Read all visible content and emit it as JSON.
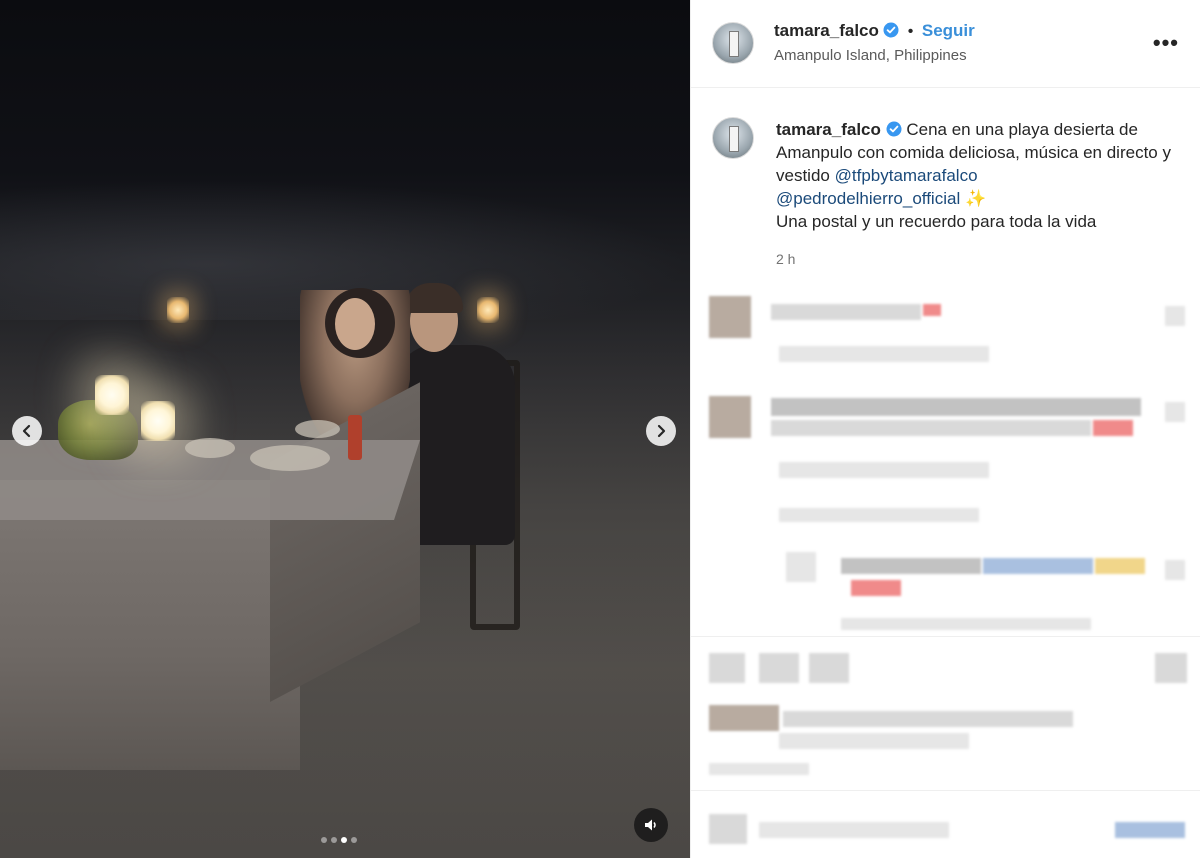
{
  "post": {
    "username": "tamara_falco",
    "follow_label": "Seguir",
    "separator": "•",
    "location": "Amanpulo Island, Philippines",
    "more_label": "•••"
  },
  "caption": {
    "username": "tamara_falco",
    "text_1": "Cena en una playa desierta de Amanpulo con comida deliciosa, música en directo y vestido",
    "mention_1": "@tfpbytamarafalco",
    "mention_2": "@pedrodelhierro_official",
    "sparkle": "✨",
    "text_2": "Una postal y un recuerdo para toda la vida",
    "time": "2 h"
  },
  "media": {
    "carousel_count": 4,
    "carousel_active_index": 2,
    "prev_icon": "chevron-left-icon",
    "next_icon": "chevron-right-icon",
    "sound_icon": "speaker-icon"
  },
  "colors": {
    "follow": "#3a8fd9",
    "mention": "#1b4a7a",
    "verified": "#3897f0"
  }
}
